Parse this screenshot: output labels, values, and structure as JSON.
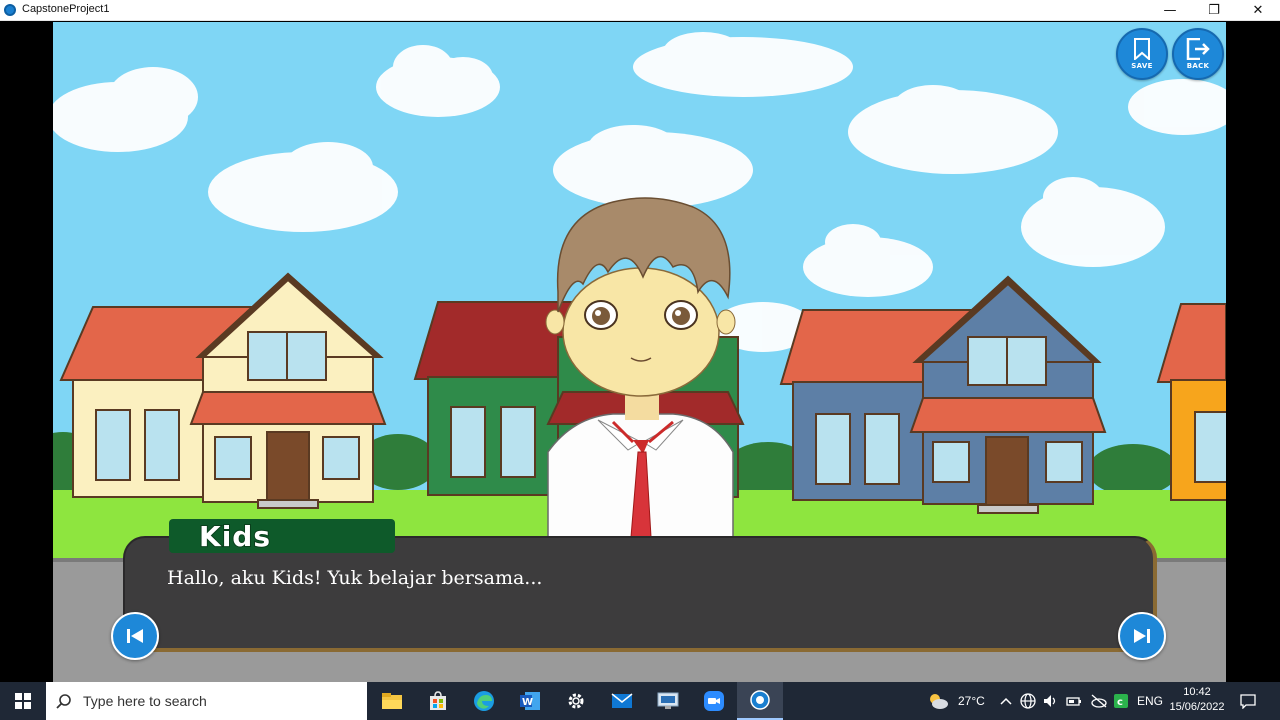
{
  "window": {
    "title": "CapstoneProject1",
    "minimize": "—",
    "restore": "❐",
    "close": "✕"
  },
  "game": {
    "save_label": "SAVE",
    "back_label": "BACK",
    "speaker": "Kids",
    "dialogue": "Hallo, aku Kids! Yuk belajar bersama...",
    "prev_icon": "skip-previous-icon",
    "next_icon": "skip-next-icon"
  },
  "taskbar": {
    "search_placeholder": "Type here to search",
    "apps": [
      "file-explorer-icon",
      "microsoft-store-icon",
      "edge-icon",
      "word-icon",
      "settings-icon",
      "mail-icon",
      "remote-desktop-icon",
      "zoom-icon",
      "game-app-icon"
    ],
    "weather": "27°C",
    "language": "ENG",
    "time": "10:42",
    "date": "15/06/2022"
  },
  "colors": {
    "sky": "#7fd6f5",
    "grass": "#8ee53f",
    "accent_blue": "#1e88d8",
    "name_green": "#0e5a2a",
    "dialog_bg": "#3d3c3d"
  }
}
